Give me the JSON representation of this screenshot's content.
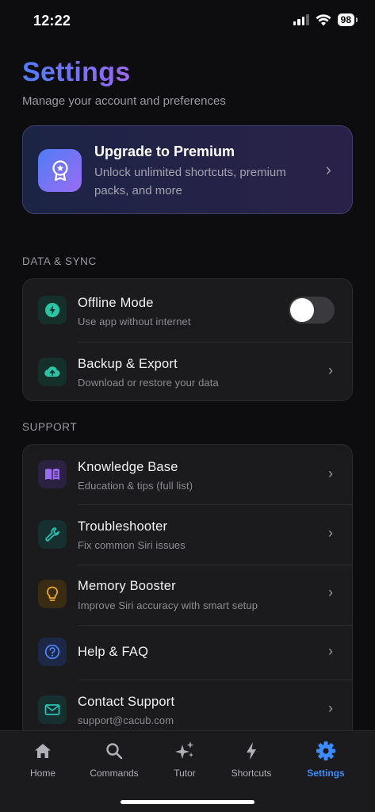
{
  "status": {
    "time": "12:22",
    "battery": "98"
  },
  "header": {
    "title": "Settings",
    "subtitle": "Manage your account and preferences"
  },
  "premium": {
    "title": "Upgrade to Premium",
    "description": "Unlock unlimited shortcuts, premium packs, and more",
    "icon": "award-badge-icon"
  },
  "sections": {
    "data_sync": {
      "label": "DATA & SYNC",
      "items": [
        {
          "title": "Offline Mode",
          "subtitle": "Use app without internet",
          "icon": "bolt-icon",
          "toggle_on": false
        },
        {
          "title": "Backup & Export",
          "subtitle": "Download or restore your data",
          "icon": "cloud-upload-icon"
        }
      ]
    },
    "support": {
      "label": "SUPPORT",
      "items": [
        {
          "title": "Knowledge Base",
          "subtitle": "Education & tips (full list)",
          "icon": "book-icon"
        },
        {
          "title": "Troubleshooter",
          "subtitle": "Fix common Siri issues",
          "icon": "wrench-icon"
        },
        {
          "title": "Memory Booster",
          "subtitle": "Improve Siri accuracy with smart setup",
          "icon": "lightbulb-icon"
        },
        {
          "title": "Help & FAQ",
          "subtitle": "",
          "icon": "question-circle-icon"
        },
        {
          "title": "Contact Support",
          "subtitle": "support@cacub.com",
          "icon": "mail-icon"
        }
      ]
    }
  },
  "tabs": [
    {
      "label": "Home",
      "icon": "home-icon",
      "active": false
    },
    {
      "label": "Commands",
      "icon": "search-icon",
      "active": false
    },
    {
      "label": "Tutor",
      "icon": "sparkles-icon",
      "active": false
    },
    {
      "label": "Shortcuts",
      "icon": "bolt-icon",
      "active": false
    },
    {
      "label": "Settings",
      "icon": "gear-icon",
      "active": true
    }
  ],
  "colors": {
    "accent": "#3d8cff",
    "gradient_start": "#4f7cf7",
    "gradient_end": "#9b67f0",
    "background": "#0d0d0f",
    "card": "#1b1b1d"
  }
}
